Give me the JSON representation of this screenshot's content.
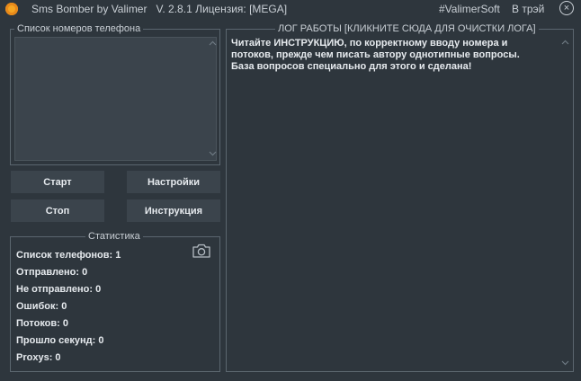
{
  "titlebar": {
    "title": "Sms Bomber by Valimer   V. 2.8.1 Лицензия: [MEGA]",
    "link_site": "#ValimerSoft",
    "link_tray": "В трэй",
    "close_glyph": "×"
  },
  "phones": {
    "title": "Список номеров телефона",
    "value": ""
  },
  "buttons": {
    "start": "Старт",
    "settings": "Настройки",
    "stop": "Стоп",
    "instruction": "Инструкция"
  },
  "stats": {
    "title": "Статистика",
    "phones": "Список телефонов: 1",
    "sent": "Отправлено: 0",
    "not_sent": "Не отправлено: 0",
    "errors": "Ошибок: 0",
    "threads": "Потоков: 0",
    "seconds": "Прошло секунд: 0",
    "proxys": "Proxys: 0"
  },
  "log": {
    "title": "ЛОГ РАБОТЫ [КЛИКНИТЕ СЮДА ДЛЯ ОЧИСТКИ ЛОГА]",
    "lines": [
      "Читайте ИНСТРУКЦИЮ, по корректному вводу номера и",
      "потоков, прежде чем писать автору однотипные вопросы.",
      "База вопросов специально для этого и сделана!"
    ]
  },
  "colors": {
    "background": "#2e363d",
    "panel": "#3b444c",
    "border": "#5b666f",
    "accent": "#f5a623"
  },
  "icons": {
    "app": "app-logo-icon",
    "camera": "camera-icon",
    "close": "close-icon",
    "scroll_up": "scroll-up-icon",
    "scroll_down": "scroll-down-icon"
  }
}
